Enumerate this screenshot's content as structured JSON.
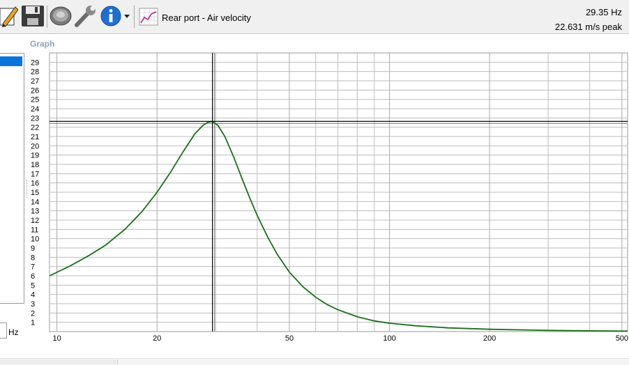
{
  "window": {
    "graph_name": "Rear port - Air velocity",
    "readout_frequency": "29.35 Hz",
    "readout_peak": "22.631 m/s peak"
  },
  "toolbar": {
    "icons": [
      "edit-pencil-icon",
      "save-disk-icon",
      "speaker-driver-icon",
      "wrench-icon",
      "info-icon",
      "dropdown-arrow-icon",
      "graph-icon"
    ]
  },
  "panel": {
    "graph_label": "Graph",
    "unit_label": "Hz"
  },
  "colors": {
    "curve": "#1a6e1a",
    "grid": "#bdbdbd",
    "cursor": "#000000",
    "selection": "#0a74d8"
  },
  "chart_data": {
    "type": "line",
    "x_scale": "log",
    "xlim": [
      9.5,
      520
    ],
    "ylim": [
      0,
      30
    ],
    "x_ticks": [
      10,
      20,
      50,
      100,
      200,
      500
    ],
    "y_ticks": [
      1,
      2,
      3,
      4,
      5,
      6,
      7,
      8,
      9,
      10,
      11,
      12,
      13,
      14,
      15,
      16,
      17,
      18,
      19,
      20,
      21,
      22,
      23,
      24,
      25,
      26,
      27,
      28,
      29
    ],
    "cursor": {
      "x": 29.35,
      "y": 22.631
    },
    "series": [
      {
        "x": [
          9.5,
          11,
          12.5,
          14,
          16,
          18,
          20,
          22,
          24,
          26,
          27.5,
          28.5,
          29.35,
          30.5,
          32,
          34,
          36,
          38,
          40,
          43,
          46,
          50,
          55,
          60,
          65,
          70,
          80,
          90,
          100,
          120,
          150,
          200,
          300,
          400,
          520
        ],
        "y": [
          6.0,
          7.1,
          8.2,
          9.3,
          11.0,
          12.9,
          15.0,
          17.2,
          19.4,
          21.3,
          22.2,
          22.55,
          22.63,
          22.2,
          21.0,
          18.8,
          16.5,
          14.4,
          12.5,
          10.2,
          8.3,
          6.4,
          4.8,
          3.7,
          2.9,
          2.35,
          1.6,
          1.15,
          0.9,
          0.62,
          0.4,
          0.25,
          0.13,
          0.08,
          0.05
        ]
      }
    ]
  }
}
